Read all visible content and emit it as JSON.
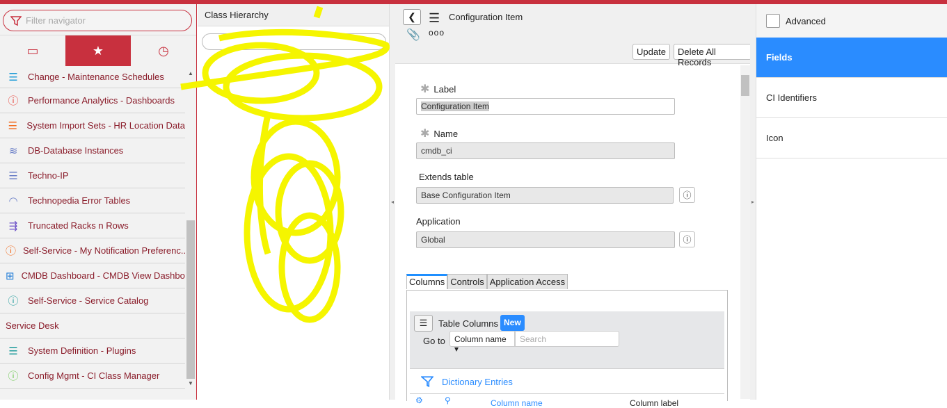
{
  "nav": {
    "filter_placeholder": "Filter navigator",
    "tabs": [
      "all-applications",
      "favorites",
      "history"
    ],
    "items": [
      {
        "label": "Change - Maintenance Schedules",
        "icon": "list-icon",
        "color": "#1e9bd7"
      },
      {
        "label": "Performance Analytics - Dashboards",
        "icon": "info-icon",
        "color": "#e8453c"
      },
      {
        "label": "System Import Sets - HR Location Data",
        "icon": "list-icon",
        "color": "#f26b1d"
      },
      {
        "label": "DB-Database Instances",
        "icon": "database-icon",
        "color": "#6b7fc7"
      },
      {
        "label": "Techno-IP",
        "icon": "list-icon",
        "color": "#6b7fc7"
      },
      {
        "label": "Technopedia Error Tables",
        "icon": "gauge-icon",
        "color": "#6b7fc7"
      },
      {
        "label": "Truncated Racks n Rows",
        "icon": "indent-icon",
        "color": "#6b4fc7"
      },
      {
        "label": "Self-Service - My Notification Preferenc...",
        "icon": "info-icon",
        "color": "#f26b1d"
      },
      {
        "label": "CMDB Dashboard - CMDB View Dashbo...",
        "icon": "grid-icon",
        "color": "#1e7bd7"
      },
      {
        "label": "Self-Service - Service Catalog",
        "icon": "info-icon",
        "color": "#1e9b9b"
      },
      {
        "label": "Service Desk",
        "section": true
      },
      {
        "label": "System Definition - Plugins",
        "icon": "list-icon",
        "color": "#1e9b9b"
      },
      {
        "label": "Config Mgmt - CI Class Manager",
        "icon": "info-icon",
        "color": "#6bc74f"
      }
    ]
  },
  "hierarchy": {
    "title": "Class Hierarchy"
  },
  "form": {
    "title": "Configuration Item",
    "update": "Update",
    "delete_all": "Delete All Records",
    "more": "ooo",
    "label_label": "Label",
    "label_value": "Configuration Item",
    "name_label": "Name",
    "name_value": "cmdb_ci",
    "extends_label": "Extends table",
    "extends_value": "Base Configuration Item",
    "app_label": "Application",
    "app_value": "Global",
    "tabs": [
      "Columns",
      "Controls",
      "Application Access"
    ],
    "table_columns": "Table Columns",
    "new": "New",
    "goto": "Go to",
    "goto_field": "Column name",
    "search_placeholder": "Search",
    "dictionary": "Dictionary Entries",
    "col_headers": [
      "Column name",
      "Column label"
    ]
  },
  "right": {
    "advanced": "Advanced",
    "items": [
      "Fields",
      "CI Identifiers",
      "Icon"
    ]
  }
}
